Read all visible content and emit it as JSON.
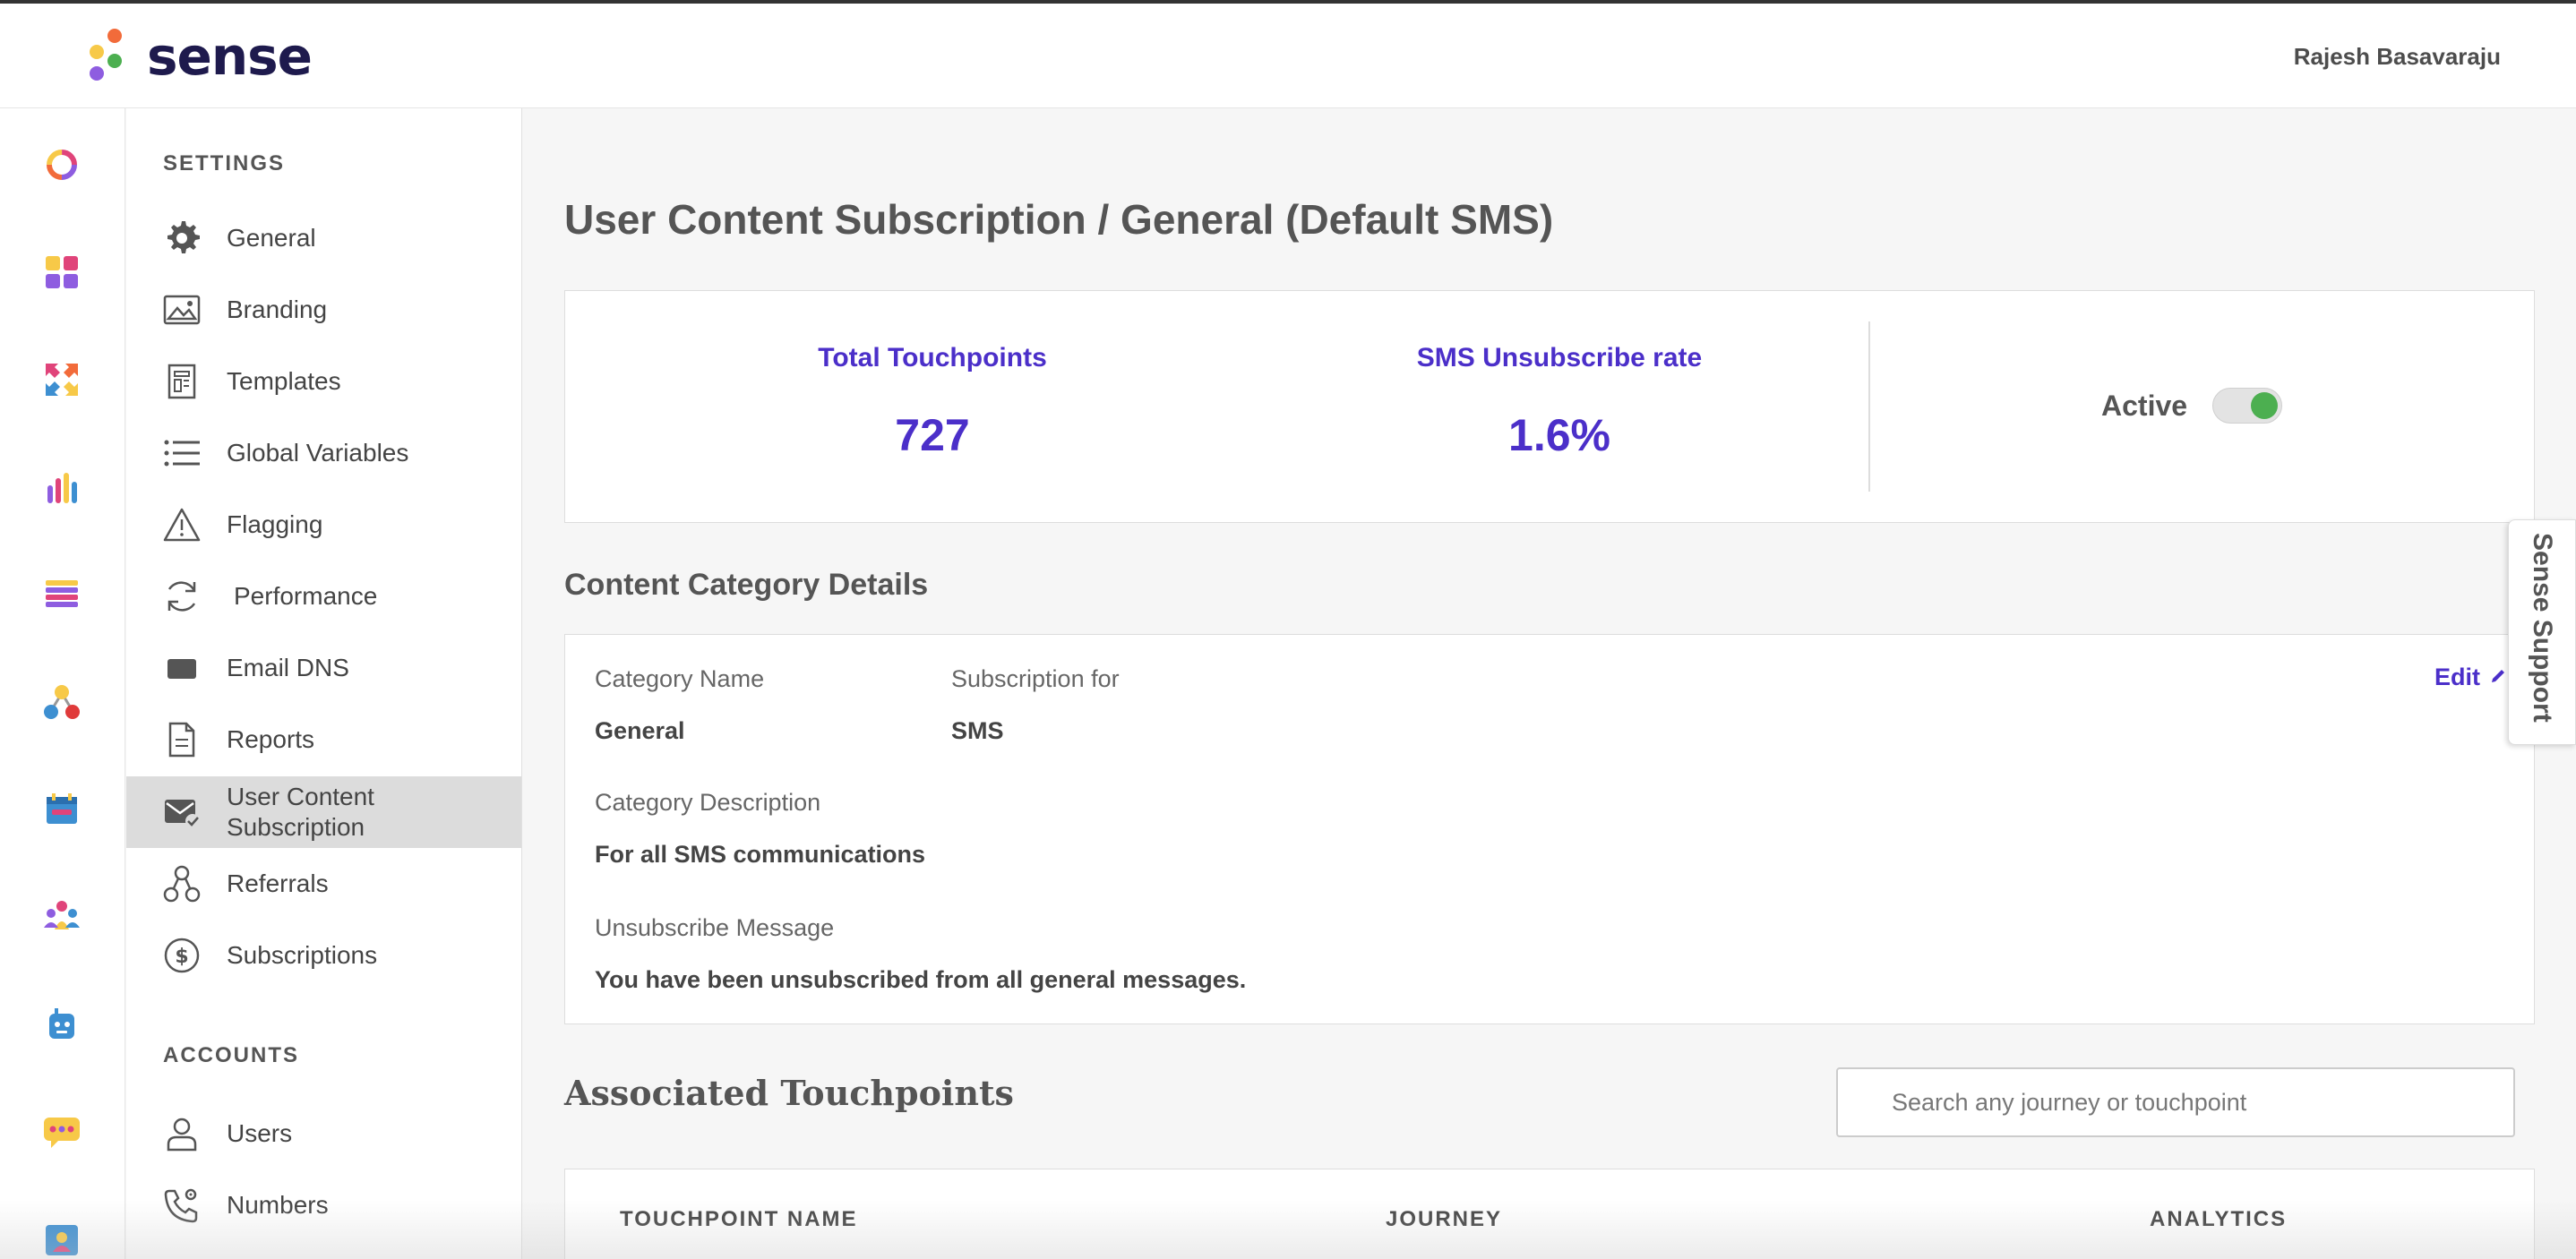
{
  "brand": {
    "name": "sense",
    "dot_colors": [
      "#f26b3a",
      "#f7c948",
      "#4caf50",
      "#8e5de0"
    ]
  },
  "header": {
    "user_name": "Rajesh Basavaraju"
  },
  "rail": {
    "icons": [
      "analytics-donut-icon",
      "dashboard-grid-icon",
      "journeys-arrows-icon",
      "bar-chart-icon",
      "list-stack-icon",
      "network-icon",
      "calendar-icon",
      "audience-icon",
      "bot-icon",
      "chat-icon",
      "contacts-icon"
    ]
  },
  "menu": {
    "settings_heading": "SETTINGS",
    "items": [
      {
        "label": "General",
        "icon": "gear-icon"
      },
      {
        "label": "Branding",
        "icon": "image-icon"
      },
      {
        "label": "Templates",
        "icon": "template-icon"
      },
      {
        "label": "Global Variables",
        "icon": "list-icon"
      },
      {
        "label": "Flagging",
        "icon": "warning-icon"
      },
      {
        "label": "Performance",
        "icon": "refresh-icon"
      },
      {
        "label": "Email DNS",
        "icon": "envelope-icon"
      },
      {
        "label": "Reports",
        "icon": "report-icon"
      },
      {
        "label": "User Content Subscription",
        "icon": "mail-check-icon"
      },
      {
        "label": "Referrals",
        "icon": "referral-icon"
      },
      {
        "label": "Subscriptions",
        "icon": "dollar-icon"
      }
    ],
    "accounts_heading": "ACCOUNTS",
    "account_items": [
      {
        "label": "Users",
        "icon": "user-icon"
      },
      {
        "label": "Numbers",
        "icon": "phone-settings-icon"
      }
    ]
  },
  "main": {
    "title": "User Content Subscription / General (Default SMS)",
    "stats": {
      "total_touchpoints_label": "Total Touchpoints",
      "total_touchpoints_value": "727",
      "unsubscribe_label": "SMS Unsubscribe rate",
      "unsubscribe_value": "1.6%",
      "active_label": "Active",
      "active": true
    },
    "details_title": "Content Category Details",
    "details": {
      "category_name_label": "Category Name",
      "category_name_value": "General",
      "subscription_for_label": "Subscription for",
      "subscription_for_value": "SMS",
      "description_label": "Category Description",
      "description_value": "For all SMS communications",
      "unsub_message_label": "Unsubscribe Message",
      "unsub_message_value": "You have been unsubscribed from all general messages.",
      "edit_label": "Edit"
    },
    "associated_title": "Associated Touchpoints",
    "search_placeholder": "Search any journey or touchpoint",
    "table_headers": [
      "TOUCHPOINT NAME",
      "JOURNEY",
      "ANALYTICS"
    ]
  },
  "support_tab": "Sense Support",
  "colors": {
    "accent": "#4b2fc9",
    "toggle_on": "#4caf50"
  }
}
